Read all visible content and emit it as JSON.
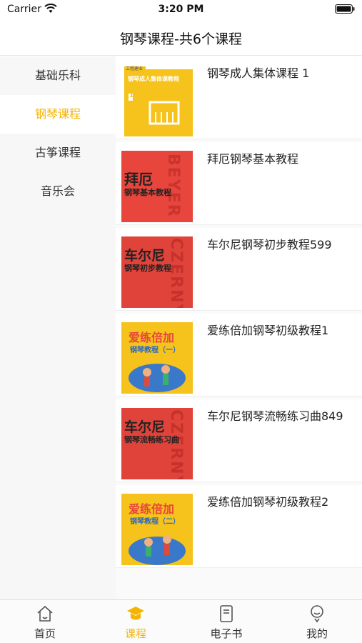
{
  "status_bar": {
    "carrier": "Carrier",
    "time": "3:20 PM"
  },
  "nav": {
    "title": "钢琴课程-共6个课程"
  },
  "sidebar": {
    "items": [
      {
        "label": "基础乐科",
        "active": false
      },
      {
        "label": "钢琴课程",
        "active": true
      },
      {
        "label": "古筝课程",
        "active": false
      },
      {
        "label": "音乐会",
        "active": false
      }
    ]
  },
  "courses": [
    {
      "title": "钢琴成人集体课程 1",
      "cover": {
        "main": "钢琴成人集体课教程",
        "badge": "1",
        "brand": "工程建业"
      }
    },
    {
      "title": "拜厄钢琴基本教程",
      "cover": {
        "main": "拜厄",
        "sub": "钢琴基本教程",
        "side": "BEYER"
      }
    },
    {
      "title": "车尔尼钢琴初步教程599",
      "cover": {
        "main": "车尔尼",
        "sub": "钢琴初步教程",
        "side": "CZERNY"
      }
    },
    {
      "title": "爱练倍加钢琴初级教程1",
      "cover": {
        "main": "爱练倍加",
        "sub": "钢琴教程（一）"
      }
    },
    {
      "title": "车尔尼钢琴流畅练习曲849",
      "cover": {
        "main": "车尔尼",
        "sub": "钢琴流畅练习曲",
        "side": "CZERNY"
      }
    },
    {
      "title": "爱练倍加钢琴初级教程2",
      "cover": {
        "main": "爱练倍加",
        "sub": "钢琴教程（二）"
      }
    }
  ],
  "tabs": [
    {
      "label": "首页",
      "icon": "home-icon",
      "active": false
    },
    {
      "label": "课程",
      "icon": "graduation-cap-icon",
      "active": true
    },
    {
      "label": "电子书",
      "icon": "book-icon",
      "active": false
    },
    {
      "label": "我的",
      "icon": "user-icon",
      "active": false
    }
  ],
  "colors": {
    "accent": "#f5b400",
    "cover_red": "#e8453c",
    "cover_yellow": "#f6c21c"
  }
}
